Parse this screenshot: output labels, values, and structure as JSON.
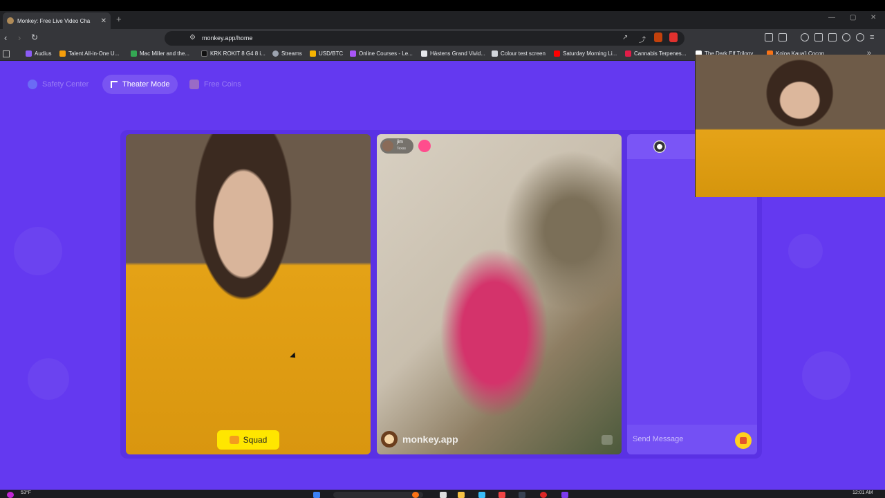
{
  "browser": {
    "tab_title": "Monkey: Free Live Video Cha",
    "url": "monkey.app/home",
    "bookmarks": [
      {
        "label": "Audius",
        "color": "#8b5cf6"
      },
      {
        "label": "Talent All-in-One U...",
        "color": "#f59e0b"
      },
      {
        "label": "Mac Miller and the...",
        "color": "#34a853"
      },
      {
        "label": "KRK ROKIT 8 G4 8 i...",
        "color": "#111111"
      },
      {
        "label": "Streams",
        "color": "#9ca3af"
      },
      {
        "label": "USD/BTC",
        "color": "#f5b301"
      },
      {
        "label": "Online Courses - Le...",
        "color": "#a855f7"
      },
      {
        "label": "Hästens Grand Vivid...",
        "color": "#e5e7eb"
      },
      {
        "label": "Colour test screen",
        "color": "#d1d5db"
      },
      {
        "label": "Saturday Morning Li...",
        "color": "#ff0000"
      },
      {
        "label": "Cannabis Terpenes...",
        "color": "#e11d48"
      },
      {
        "label": "The Dark Elf Trilogy...",
        "color": "#ffffff"
      },
      {
        "label": "Koloa Kaua'i Cocon...",
        "color": "#f97316"
      }
    ]
  },
  "header": {
    "safety_center": "Safety Center",
    "theater_mode": "Theater Mode",
    "free_coins": "Free Coins"
  },
  "video": {
    "partner_name": "jim",
    "partner_location": "Texas",
    "squad_label": "Squad",
    "watermark": "monkey.app"
  },
  "chat": {
    "input_placeholder": "Send Message"
  },
  "taskbar": {
    "weather": "53°F",
    "time": "12:01 AM"
  },
  "colors": {
    "page_bg": "#6439f0",
    "accent_yellow": "#ffe600",
    "chat_bg": "#6c44f2"
  }
}
